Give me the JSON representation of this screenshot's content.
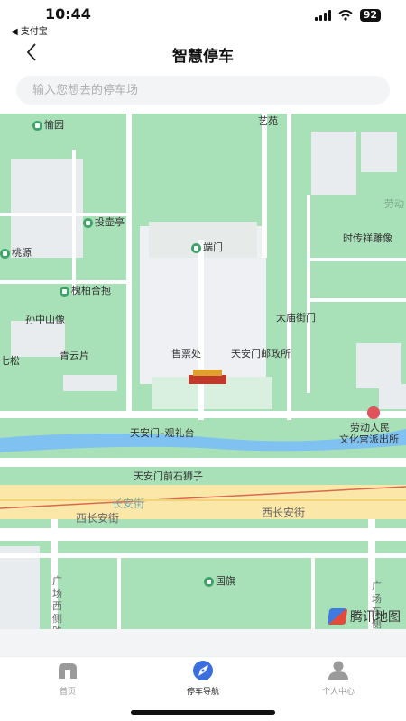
{
  "status": {
    "time": "10:44",
    "back_app": "◀ 支付宝",
    "battery": "92"
  },
  "header": {
    "title": "智慧停车"
  },
  "search": {
    "placeholder": "输入您想去的停车场"
  },
  "map": {
    "labels": [
      {
        "key": "yiyuan",
        "text": "艺苑"
      },
      {
        "key": "yuyuan",
        "text": "愉园"
      },
      {
        "key": "touhuting",
        "text": "投壶亭"
      },
      {
        "key": "taoyuan",
        "text": "桃源"
      },
      {
        "key": "duanmen",
        "text": "端门"
      },
      {
        "key": "shichuan",
        "text": "时传祥雕像"
      },
      {
        "key": "huaibai",
        "text": "槐柏合抱"
      },
      {
        "key": "sunzhongshan",
        "text": "孙中山像"
      },
      {
        "key": "taimiao",
        "text": "太庙街门"
      },
      {
        "key": "qingyunpian",
        "text": "青云片"
      },
      {
        "key": "qisong",
        "text": "七松"
      },
      {
        "key": "shoupiaochu",
        "text": "售票处"
      },
      {
        "key": "youzhengsuo",
        "text": "天安门邮政所"
      },
      {
        "key": "guanlitai",
        "text": "天安门–观礼台"
      },
      {
        "key": "laodong",
        "text": "劳动人民"
      },
      {
        "key": "wenhuagong",
        "text": "文化宫派出所"
      },
      {
        "key": "shishizi",
        "text": "天安门前石狮子"
      },
      {
        "key": "guoqi",
        "text": "国旗"
      },
      {
        "key": "laodong_edge",
        "text": "劳动"
      }
    ],
    "roads": {
      "changan": "长安街",
      "xichangan_left": "西长安街",
      "xichangan_right": "西长安街",
      "guangchang_west": "广场西侧路",
      "guangchang_east": "广场东侧路"
    },
    "logo_text": "腾讯地图"
  },
  "tabs": [
    {
      "label": "首页",
      "icon": "home-icon"
    },
    {
      "label": "停车导航",
      "icon": "compass-icon"
    },
    {
      "label": "个人中心",
      "icon": "user-icon"
    }
  ],
  "colors": {
    "map_green": "#a8e0b8",
    "road": "#ffffff",
    "river": "#7fc1f0",
    "accent": "#3b6fe0"
  }
}
